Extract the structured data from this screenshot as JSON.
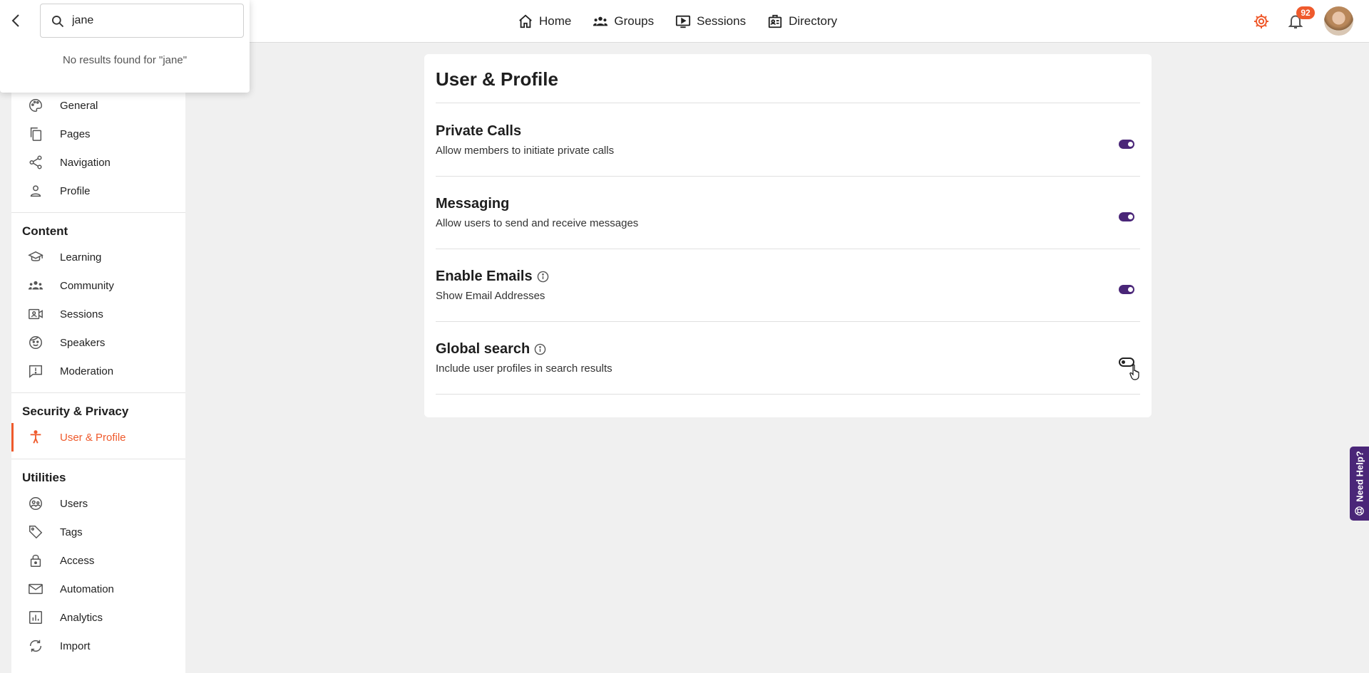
{
  "topnav": {
    "items": [
      {
        "label": "Home",
        "icon": "home-icon"
      },
      {
        "label": "Groups",
        "icon": "groups-icon"
      },
      {
        "label": "Sessions",
        "icon": "sessions-icon"
      },
      {
        "label": "Directory",
        "icon": "directory-icon"
      }
    ],
    "notification_count": "92"
  },
  "search": {
    "query": "jane",
    "no_results": "No results found for \"jane\""
  },
  "sidebar": {
    "top_items": [
      {
        "label": "General",
        "icon": "palette-icon"
      },
      {
        "label": "Pages",
        "icon": "pages-icon"
      },
      {
        "label": "Navigation",
        "icon": "share-icon"
      },
      {
        "label": "Profile",
        "icon": "person-icon"
      }
    ],
    "content_heading": "Content",
    "content_items": [
      {
        "label": "Learning",
        "icon": "graduation-cap-icon"
      },
      {
        "label": "Community",
        "icon": "community-icon"
      },
      {
        "label": "Sessions",
        "icon": "video-person-icon"
      },
      {
        "label": "Speakers",
        "icon": "face-icon"
      },
      {
        "label": "Moderation",
        "icon": "report-icon"
      }
    ],
    "security_heading": "Security & Privacy",
    "security_items": [
      {
        "label": "User & Profile",
        "icon": "accessibility-icon",
        "active": true
      }
    ],
    "utilities_heading": "Utilities",
    "utilities_items": [
      {
        "label": "Users",
        "icon": "users-icon"
      },
      {
        "label": "Tags",
        "icon": "tag-icon"
      },
      {
        "label": "Access",
        "icon": "lock-icon"
      },
      {
        "label": "Automation",
        "icon": "mail-icon"
      },
      {
        "label": "Analytics",
        "icon": "analytics-icon"
      },
      {
        "label": "Import",
        "icon": "sync-icon"
      }
    ]
  },
  "main": {
    "title": "User & Profile",
    "settings": [
      {
        "title": "Private Calls",
        "desc": "Allow members to initiate private calls",
        "enabled": true,
        "info": false
      },
      {
        "title": "Messaging",
        "desc": "Allow users to send and receive messages",
        "enabled": true,
        "info": false
      },
      {
        "title": "Enable Emails",
        "desc": "Show Email Addresses",
        "enabled": true,
        "info": true
      },
      {
        "title": "Global search",
        "desc": "Include user profiles in search results",
        "enabled": false,
        "info": true
      }
    ]
  },
  "help": {
    "label": "Need Help?"
  },
  "colors": {
    "accent": "#ef5a2c",
    "toggle_on": "#4a2678",
    "help_tab": "#4a2678"
  }
}
